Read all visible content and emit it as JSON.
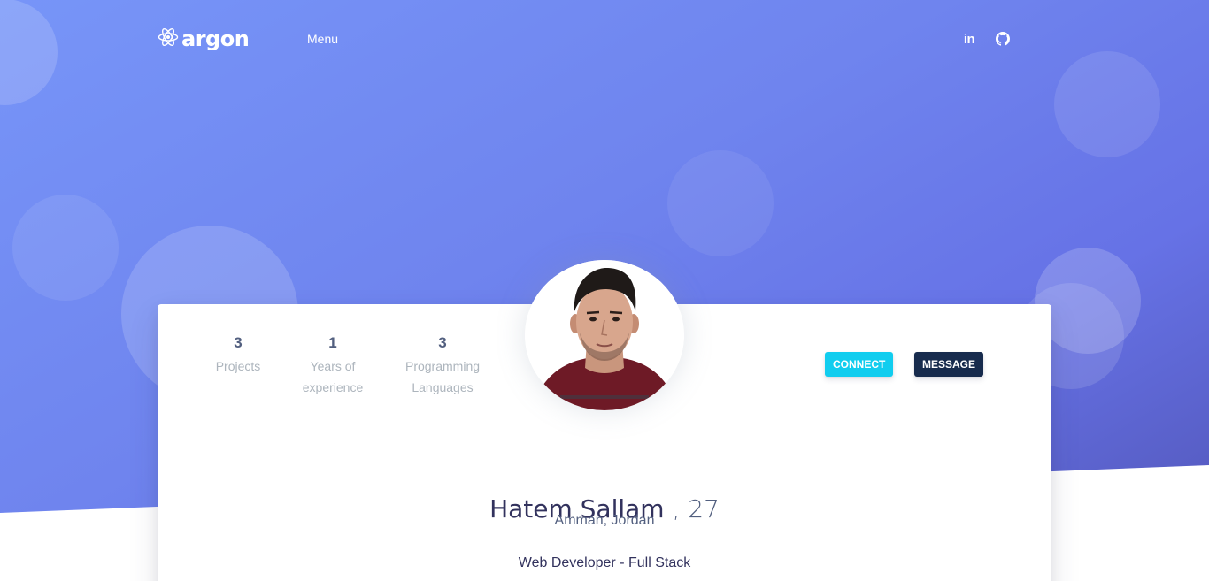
{
  "nav": {
    "brand": "argon",
    "brand_icon": "react-atom-icon",
    "menu_label": "Menu",
    "social": [
      {
        "name": "linkedin",
        "icon": "linkedin-icon",
        "glyph": "in"
      },
      {
        "name": "github",
        "icon": "github-icon"
      }
    ]
  },
  "stats": [
    {
      "value": "3",
      "label": "Projects"
    },
    {
      "value": "1",
      "label": "Years of experience"
    },
    {
      "value": "3",
      "label": "Programming Languages"
    }
  ],
  "actions": {
    "connect_label": "Connect",
    "message_label": "Message"
  },
  "profile": {
    "name": "Hatem Sallam",
    "age": ", 27",
    "location": "Amman, Jordan",
    "role": "Web Developer - Full Stack"
  },
  "colors": {
    "hero_start": "#7795f8",
    "hero_end": "#555abf",
    "connect": "#11cdef",
    "message": "#172b4d",
    "heading": "#32325d",
    "muted": "#adb5bd"
  }
}
